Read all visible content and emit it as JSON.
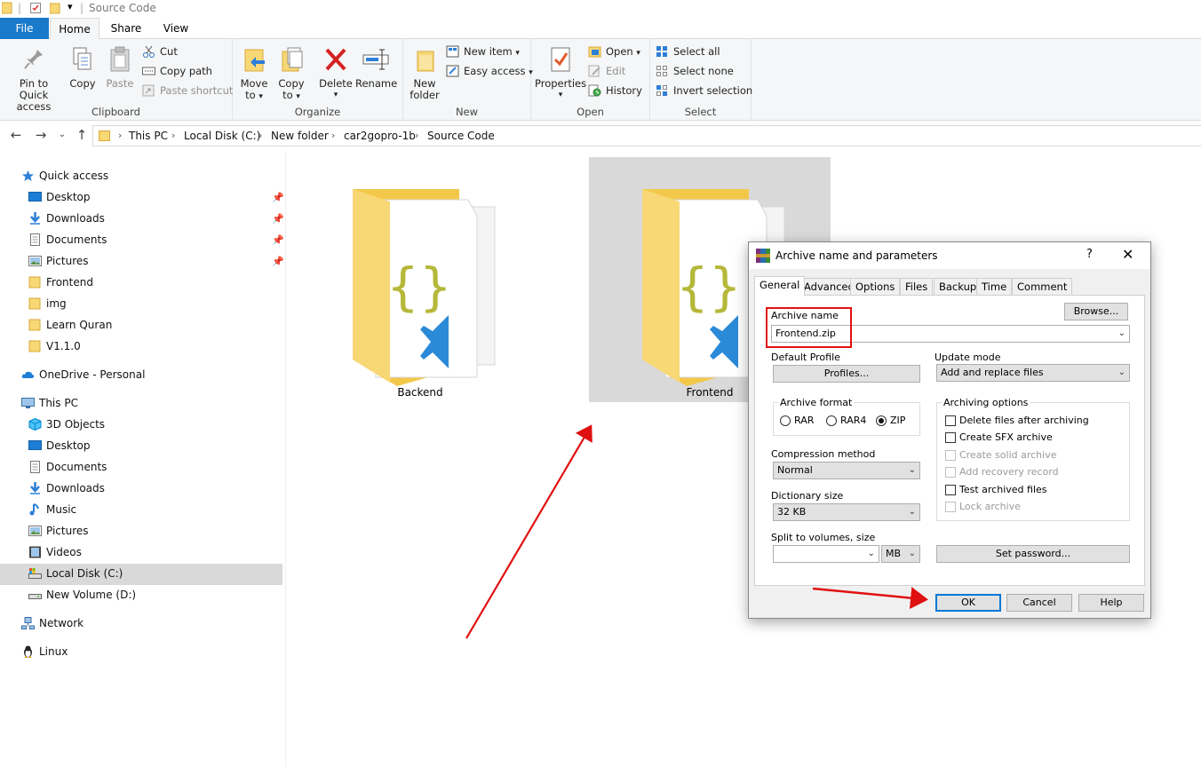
{
  "window": {
    "title": "Source Code"
  },
  "ribbon": {
    "tabs": [
      "File",
      "Home",
      "Share",
      "View"
    ],
    "clipboard": {
      "label": "Clipboard",
      "pin_label_1": "Pin to Quick",
      "pin_label_2": "access",
      "copy": "Copy",
      "paste": "Paste",
      "cut": "Cut",
      "copy_path": "Copy path",
      "paste_shortcut": "Paste shortcut"
    },
    "organize": {
      "label": "Organize",
      "move_to_1": "Move",
      "move_to_2": "to",
      "copy_to_1": "Copy",
      "copy_to_2": "to",
      "delete": "Delete",
      "rename": "Rename"
    },
    "new": {
      "label": "New",
      "new_folder_1": "New",
      "new_folder_2": "folder",
      "new_item": "New item",
      "easy_access": "Easy access"
    },
    "open": {
      "label": "Open",
      "properties": "Properties",
      "open": "Open",
      "edit": "Edit",
      "history": "History"
    },
    "select": {
      "label": "Select",
      "select_all": "Select all",
      "select_none": "Select none",
      "invert": "Invert selection"
    }
  },
  "address": {
    "crumbs": [
      "This PC",
      "Local Disk (C:)",
      "New folder",
      "car2gopro-1b",
      "Source Code"
    ]
  },
  "nav": {
    "quick_access": "Quick access",
    "quick_items": [
      "Desktop",
      "Downloads",
      "Documents",
      "Pictures",
      "Frontend",
      "img",
      "Learn Quran",
      "V1.1.0"
    ],
    "onedrive": "OneDrive - Personal",
    "this_pc": "This PC",
    "pc_items": [
      "3D Objects",
      "Desktop",
      "Documents",
      "Downloads",
      "Music",
      "Pictures",
      "Videos",
      "Local Disk (C:)",
      "New Volume (D:)"
    ],
    "network": "Network",
    "linux": "Linux"
  },
  "content": {
    "folders": [
      "Backend",
      "Frontend"
    ]
  },
  "dialog": {
    "title": "Archive name and parameters",
    "help_glyph": "?",
    "close_glyph": "✕",
    "tabs": [
      "General",
      "Advanced",
      "Options",
      "Files",
      "Backup",
      "Time",
      "Comment"
    ],
    "archive_name_label": "Archive name",
    "archive_name_value": "Frontend.zip",
    "browse": "Browse...",
    "default_profile_label": "Default Profile",
    "profiles": "Profiles...",
    "update_mode_label": "Update mode",
    "update_mode_value": "Add and replace files",
    "archive_format_label": "Archive format",
    "formats": [
      "RAR",
      "RAR4",
      "ZIP"
    ],
    "selected_format": "ZIP",
    "archiving_options_label": "Archiving options",
    "options": [
      {
        "label": "Delete files after archiving",
        "enabled": true,
        "checked": false
      },
      {
        "label": "Create SFX archive",
        "enabled": true,
        "checked": false
      },
      {
        "label": "Create solid archive",
        "enabled": false,
        "checked": false
      },
      {
        "label": "Add recovery record",
        "enabled": false,
        "checked": false
      },
      {
        "label": "Test archived files",
        "enabled": true,
        "checked": false
      },
      {
        "label": "Lock archive",
        "enabled": false,
        "checked": false
      }
    ],
    "compression_label": "Compression method",
    "compression_value": "Normal",
    "dictionary_label": "Dictionary size",
    "dictionary_value": "32 KB",
    "split_label": "Split to volumes, size",
    "split_value": "",
    "split_unit": "MB",
    "set_password": "Set password...",
    "ok": "OK",
    "cancel": "Cancel",
    "help": "Help"
  },
  "colors": {
    "file_tab": "#1979ca",
    "selection": "#d9d9d9",
    "folder_yellow": "#f8d775",
    "annotation_red": "#e01010",
    "primary_border": "#0078d7"
  }
}
